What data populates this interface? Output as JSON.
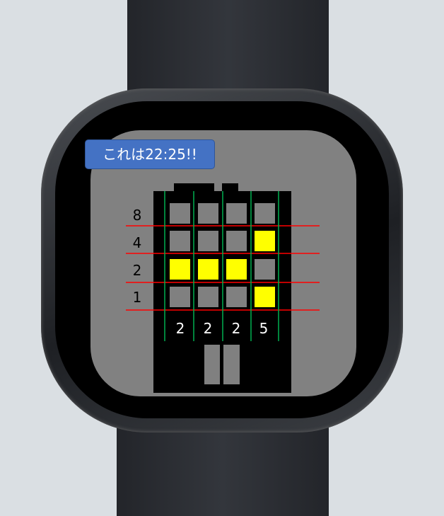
{
  "speech_bubble": {
    "text": "これは22:25!!"
  },
  "row_weights": [
    "8",
    "4",
    "2",
    "1"
  ],
  "digits": [
    "2",
    "2",
    "2",
    "5"
  ],
  "grid": {
    "columns_bits": [
      [
        0,
        0,
        1,
        0
      ],
      [
        0,
        0,
        1,
        0
      ],
      [
        0,
        0,
        1,
        0
      ],
      [
        0,
        1,
        0,
        1
      ]
    ]
  },
  "colors": {
    "lit": "#ffff00",
    "unlit": "#808080",
    "building": "#000000",
    "row_line": "#ff0000",
    "column_line": "#00b050",
    "bubble": "#4472c4"
  }
}
